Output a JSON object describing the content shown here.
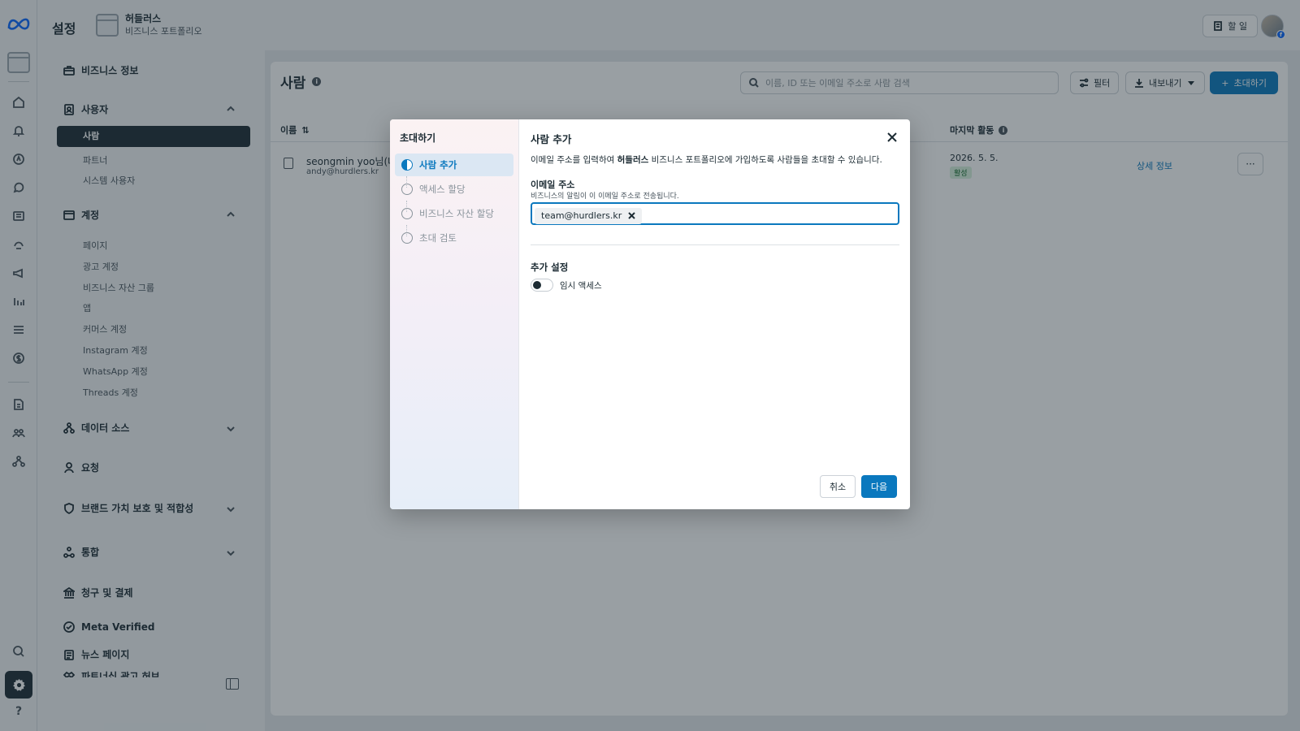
{
  "header": {
    "page_title": "설정",
    "business_name": "허들러스",
    "business_type": "비즈니스 포트폴리오",
    "todo_label": "할 일"
  },
  "sidebar": {
    "sections": [
      {
        "label": "비즈니스 정보",
        "icon": "briefcase-icon"
      },
      {
        "label": "사용자",
        "icon": "users-badge-icon"
      },
      {
        "label": "계정",
        "icon": "folder-icon"
      },
      {
        "label": "데이터 소스",
        "icon": "data-source-icon"
      },
      {
        "label": "요청",
        "icon": "person-request-icon"
      },
      {
        "label": "브랜드 가치 보호 및 적합성",
        "icon": "shield-icon"
      },
      {
        "label": "통합",
        "icon": "integration-icon"
      },
      {
        "label": "청구 및 결제",
        "icon": "bank-icon"
      },
      {
        "label": "Meta Verified",
        "icon": "verified-badge-icon"
      },
      {
        "label": "뉴스 페이지",
        "icon": "news-icon"
      },
      {
        "label": "파트너십 광고 허브",
        "icon": "handshake-icon"
      }
    ],
    "users_items": [
      "사람",
      "파트너",
      "시스템 사용자"
    ],
    "accounts_items": [
      "페이지",
      "광고 계정",
      "비즈니스 자산 그룹",
      "앱",
      "커머스 계정",
      "Instagram 계정",
      "WhatsApp 계정",
      "Threads 계정"
    ]
  },
  "main": {
    "title": "사람",
    "search_placeholder": "이름, ID 또는 이메일 주소로 사람 검색",
    "filter_label": "필터",
    "export_label": "내보내기",
    "invite_label": "초대하기",
    "col_name": "이름",
    "col_last_activity": "마지막 활동",
    "rows": [
      {
        "name": "seongmin yoo님(나",
        "email": "andy@hurdlers.kr",
        "last_activity": "2026. 5. 5.",
        "status": "활성",
        "details_link": "상세 정보",
        "more": "···"
      }
    ]
  },
  "modal": {
    "sidebar_title": "초대하기",
    "steps": [
      {
        "label": "사람 추가",
        "active": true
      },
      {
        "label": "액세스 할당",
        "active": false
      },
      {
        "label": "비즈니스 자산 할당",
        "active": false
      },
      {
        "label": "초대 검토",
        "active": false
      }
    ],
    "title": "사람 추가",
    "desc_before": "이메일 주소를 입력하여 ",
    "desc_bold": "허들러스",
    "desc_after": " 비즈니스 포트폴리오에 가입하도록 사람들을 초대할 수 있습니다.",
    "email_label": "이메일 주소",
    "email_help": "비즈니스의 알림이 이 이메일 주소로 전송됩니다.",
    "email_chips": [
      "team@hurdlers.kr"
    ],
    "extra_settings_title": "추가 설정",
    "temp_access_label": "임시 액세스",
    "temp_access_on": false,
    "cancel_label": "취소",
    "next_label": "다음"
  },
  "colors": {
    "accent": "#0a78be",
    "meta_blue": "#0866ff",
    "dark": "#1c2b33"
  }
}
